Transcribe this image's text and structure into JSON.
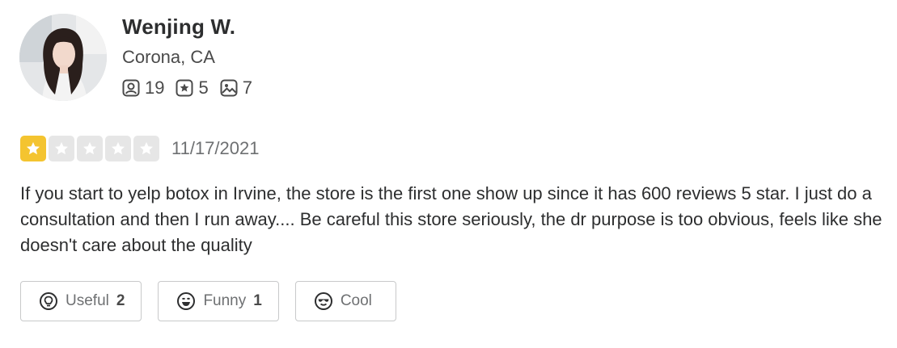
{
  "user": {
    "name": "Wenjing W.",
    "location": "Corona, CA",
    "stats": {
      "friends": "19",
      "reviews": "5",
      "photos": "7"
    }
  },
  "review": {
    "rating": 1,
    "max_rating": 5,
    "date": "11/17/2021",
    "text": "If you start to yelp botox in Irvine, the store is the first one show up since it has 600 reviews 5 star. I just do a consultation and then I run away.... Be careful this store seriously, the dr purpose is too obvious, feels like she doesn't care about the quality"
  },
  "reactions": {
    "useful": {
      "label": "Useful",
      "count": "2"
    },
    "funny": {
      "label": "Funny",
      "count": "1"
    },
    "cool": {
      "label": "Cool",
      "count": ""
    }
  },
  "colors": {
    "star_filled": "#f4c430",
    "star_empty": "#e6e6e6",
    "text": "#2d2e2f",
    "muted": "#6e7072"
  }
}
